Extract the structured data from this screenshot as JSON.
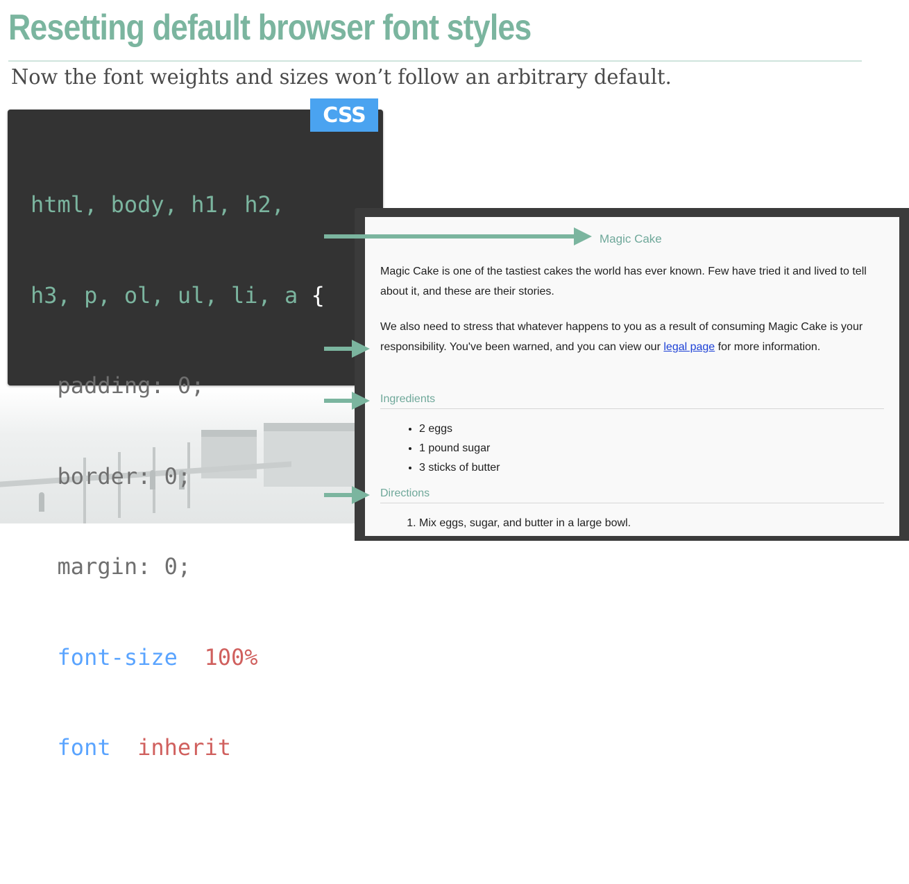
{
  "slide": {
    "title": "Resetting default browser font styles",
    "subtitle": "Now the font weights and sizes won’t follow an arbitrary default."
  },
  "code_panel": {
    "badge": "CSS",
    "selector_line_1": "html, body, h1, h2,",
    "selector_line_2": "h3, p, ol, ul, li, a",
    "open_brace": " {",
    "rule_1": "padding: 0;",
    "rule_2": "border: 0;",
    "rule_3": "margin: 0;",
    "rule_4_prop": "font-size",
    "rule_4_value": "100%",
    "rule_5_prop": "font",
    "rule_5_value": "inherit",
    "colon": ": ",
    "semicolon": ";",
    "close_brace": "}"
  },
  "browser": {
    "heading": "Magic Cake",
    "paragraph_1": "Magic Cake is one of the tastiest cakes the world has ever known. Few have tried it and lived to tell about it, and these are their stories.",
    "paragraph_2_before_link": "We also need to stress that whatever happens to you as a result of consuming Magic Cake is your responsibility. You've been warned, and you can view our ",
    "paragraph_2_link": "legal page",
    "paragraph_2_after_link": " for more information.",
    "ingredients_heading": "Ingredients",
    "ingredients": [
      "2 eggs",
      "1 pound sugar",
      "3 sticks of butter"
    ],
    "directions_heading": "Directions",
    "directions": [
      "Mix eggs, sugar, and butter in a large bowl."
    ]
  },
  "colors": {
    "accent_green": "#7bb59f",
    "badge_blue": "#4aa3f0",
    "code_background": "#333333",
    "css_property": "#5aa4ff",
    "css_value": "#d0605e",
    "link": "#1b3fd6"
  }
}
